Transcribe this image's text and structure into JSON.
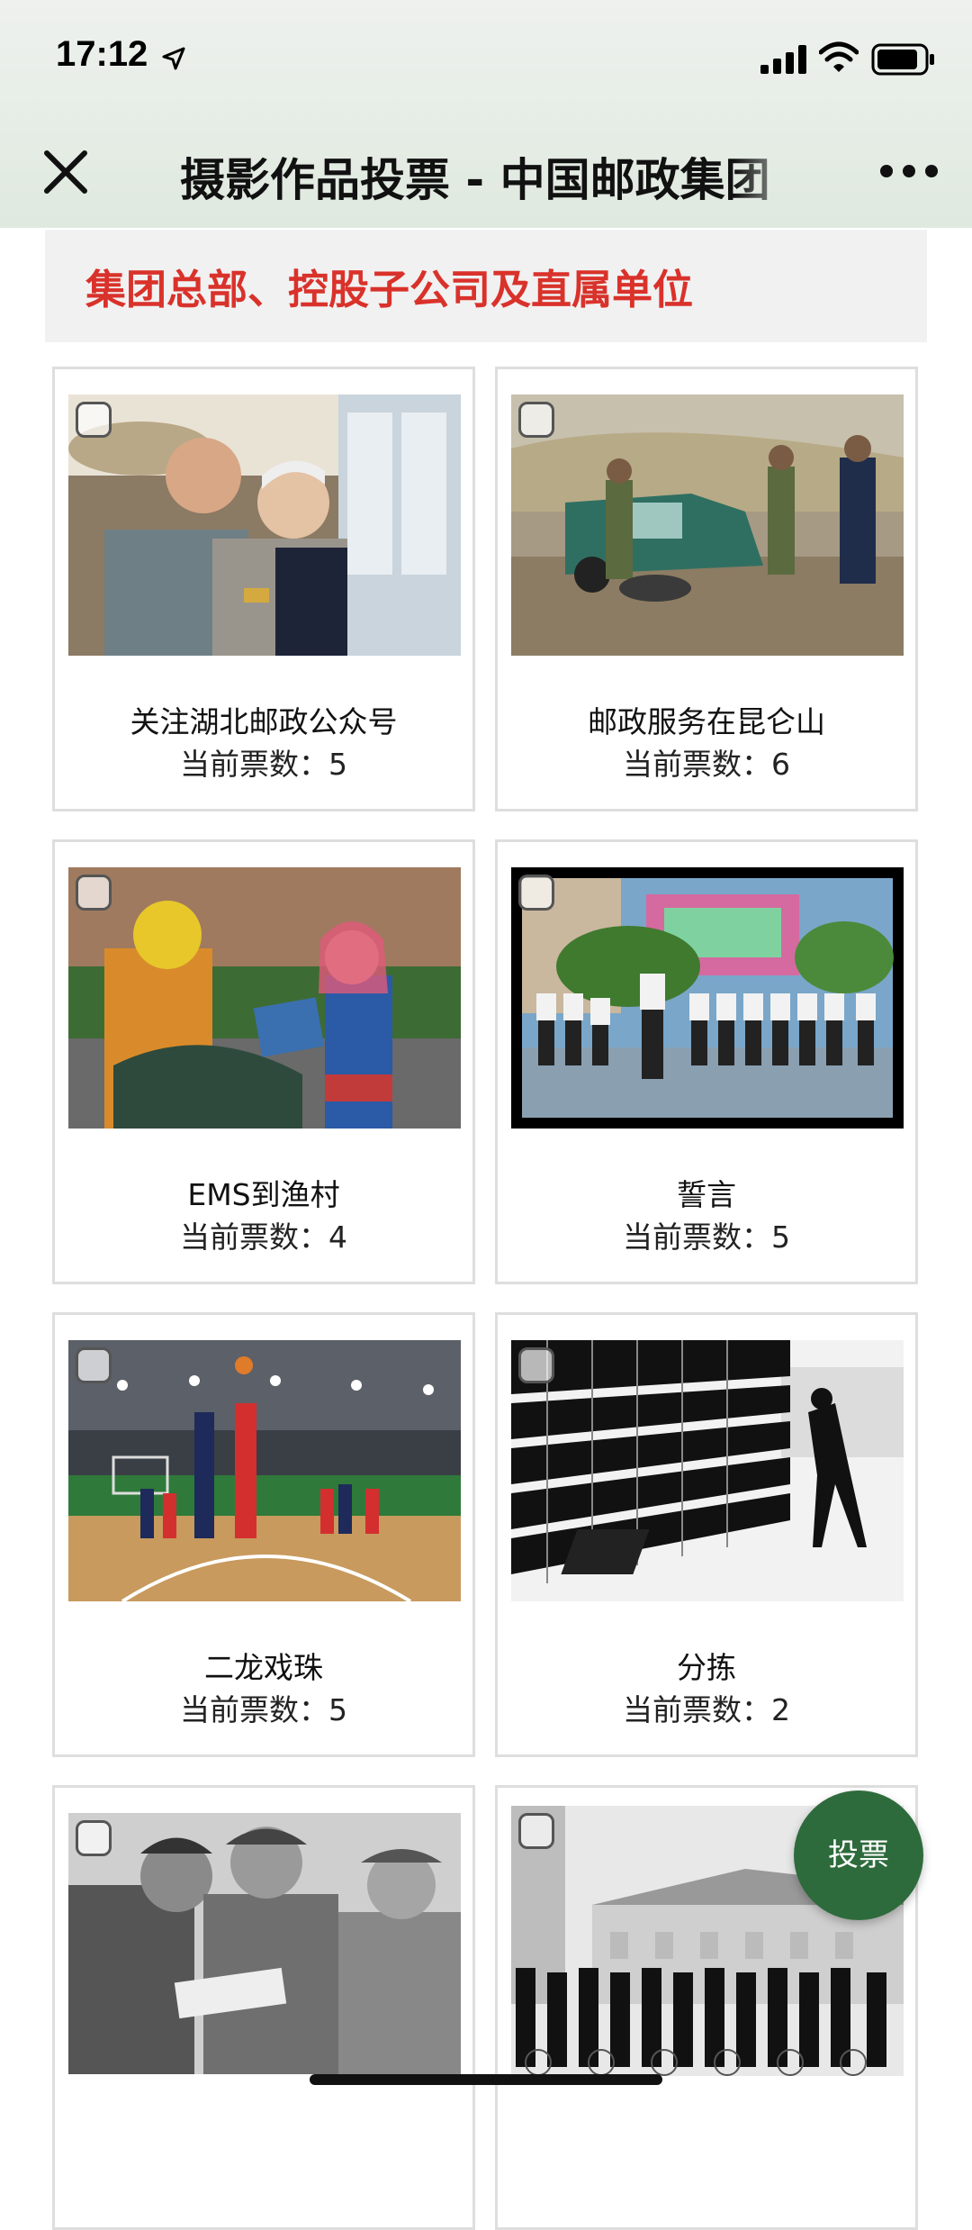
{
  "status": {
    "time": "17:12"
  },
  "nav": {
    "title": "摄影作品投票 - 中国邮政集团"
  },
  "section": {
    "title": "集团总部、控股子公司及直属单位"
  },
  "votes_prefix": "当前票数：",
  "cards": [
    {
      "title": "关注湖北邮政公众号",
      "votes": "当前票数：5",
      "photo": "people-looking-at-phone-photo"
    },
    {
      "title": "邮政服务在昆仑山",
      "votes": "当前票数：6",
      "photo": "stuck-truck-photo"
    },
    {
      "title": "EMS到渔村",
      "votes": "当前票数：4",
      "photo": "courier-delivery-photo"
    },
    {
      "title": "誓言",
      "votes": "当前票数：5",
      "photo": "oath-ceremony-photo"
    },
    {
      "title": "二龙戏珠",
      "votes": "当前票数：5",
      "photo": "basketball-game-photo"
    },
    {
      "title": "分拣",
      "votes": "当前票数：2",
      "photo": "sorting-shelves-photo"
    },
    {
      "title": "",
      "votes": "",
      "photo": "old-men-photo"
    },
    {
      "title": "",
      "votes": "",
      "photo": "cyclists-photo"
    }
  ],
  "vote_button": {
    "label": "投票"
  }
}
